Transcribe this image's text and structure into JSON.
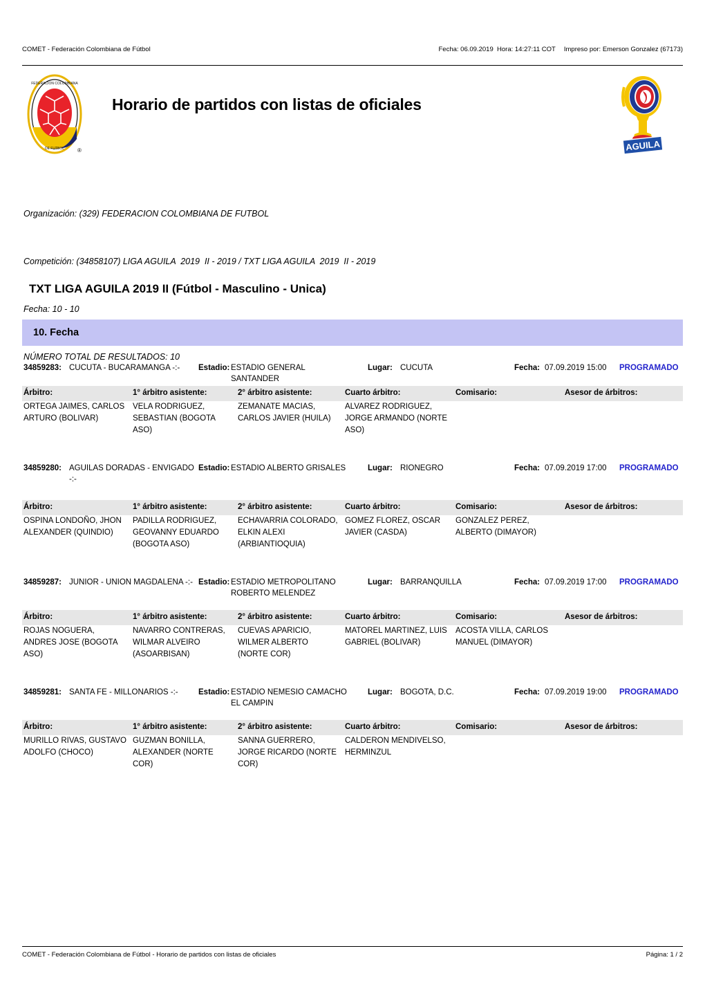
{
  "header": {
    "left": "COMET - Federación Colombiana de Fútbol",
    "fecha": "Fecha: 06.09.2019  Hora: 14:27:11 COT",
    "impreso": "Impreso por: Emerson Gonzalez (67173)"
  },
  "title": "Horario de partidos con listas de oficiales",
  "meta": {
    "organizacion": "Organización: (329) FEDERACION COLOMBIANA DE FUTBOL",
    "competicion": "Competición: (34858107) LIGA AGUILA  2019  II - 2019 / TXT LIGA AGUILA  2019  II - 2019",
    "fecha": "Fecha: 10 - 10",
    "total": "NÚMERO TOTAL DE RESULTADOS: 10"
  },
  "competition_title": "TXT LIGA AGUILA  2019  II (Fútbol - Masculino - Unica)",
  "round_band": "10. Fecha",
  "labels": {
    "estadio": "Estadio:",
    "lugar": "Lugar:",
    "fecha": "Fecha:"
  },
  "officials_columns": [
    "Árbitro:",
    "1° árbitro asistente:",
    "2° árbitro asistente:",
    "Cuarto árbitro:",
    "Comisario:",
    "Asesor de árbitros:"
  ],
  "colors": {
    "round_band_bg": "#c4c4f4",
    "officials_header_bg": "#e6e6e6",
    "status": "#2222cc"
  },
  "matches": [
    {
      "id": "34859283:",
      "teams": "CUCUTA - BUCARAMANGA  -:-",
      "estadio": "ESTADIO GENERAL SANTANDER",
      "lugar": "CUCUTA",
      "fecha": "07.09.2019 15:00",
      "status": "PROGRAMADO",
      "officials": [
        "ORTEGA JAIMES, CARLOS ARTURO (BOLIVAR)",
        "VELA RODRIGUEZ, SEBASTIAN (BOGOTA ASO)",
        "ZEMANATE MACIAS, CARLOS JAVIER (HUILA)",
        "ALVAREZ RODRIGUEZ, JORGE ARMANDO (NORTE ASO)",
        "",
        ""
      ]
    },
    {
      "id": "34859280:",
      "teams": "AGUILAS DORADAS - ENVIGADO  -:-",
      "estadio": "ESTADIO ALBERTO GRISALES",
      "lugar": "RIONEGRO",
      "fecha": "07.09.2019 17:00",
      "status": "PROGRAMADO",
      "officials": [
        "OSPINA LONDOÑO, JHON ALEXANDER (QUINDIO)",
        "PADILLA RODRIGUEZ, GEOVANNY EDUARDO (BOGOTA ASO)",
        "ECHAVARRIA COLORADO, ELKIN ALEXI (ARBIANTIOQUIA)",
        "GOMEZ FLOREZ, OSCAR JAVIER (CASDA)",
        "GONZALEZ PEREZ, ALBERTO (DIMAYOR)",
        ""
      ]
    },
    {
      "id": "34859287:",
      "teams": "JUNIOR - UNION MAGDALENA  -:-",
      "estadio": "ESTADIO METROPOLITANO ROBERTO MELENDEZ",
      "lugar": "BARRANQUILLA",
      "fecha": "07.09.2019 17:00",
      "status": "PROGRAMADO",
      "officials": [
        "ROJAS NOGUERA, ANDRES JOSE (BOGOTA ASO)",
        "NAVARRO CONTRERAS, WILMAR ALVEIRO (ASOARBISAN)",
        "CUEVAS APARICIO, WILMER ALBERTO (NORTE COR)",
        "MATOREL MARTINEZ, LUIS GABRIEL (BOLIVAR)",
        "ACOSTA VILLA, CARLOS MANUEL (DIMAYOR)",
        ""
      ]
    },
    {
      "id": "34859281:",
      "teams": "SANTA FE - MILLONARIOS  -:-",
      "estadio": "ESTADIO NEMESIO CAMACHO EL CAMPIN",
      "lugar": "BOGOTA, D.C.",
      "fecha": "07.09.2019 19:00",
      "status": "PROGRAMADO",
      "officials": [
        "MURILLO RIVAS, GUSTAVO ADOLFO (CHOCO)",
        "GUZMAN BONILLA, ALEXANDER (NORTE COR)",
        "SANNA GUERRERO, JORGE RICARDO (NORTE COR)",
        "CALDERON MENDIVELSO, HERMINZUL",
        "",
        ""
      ]
    }
  ],
  "footer": {
    "left": "COMET - Federación Colombiana de Fútbol - Horario de partidos con listas de oficiales",
    "right": "Página: 1 / 2"
  }
}
